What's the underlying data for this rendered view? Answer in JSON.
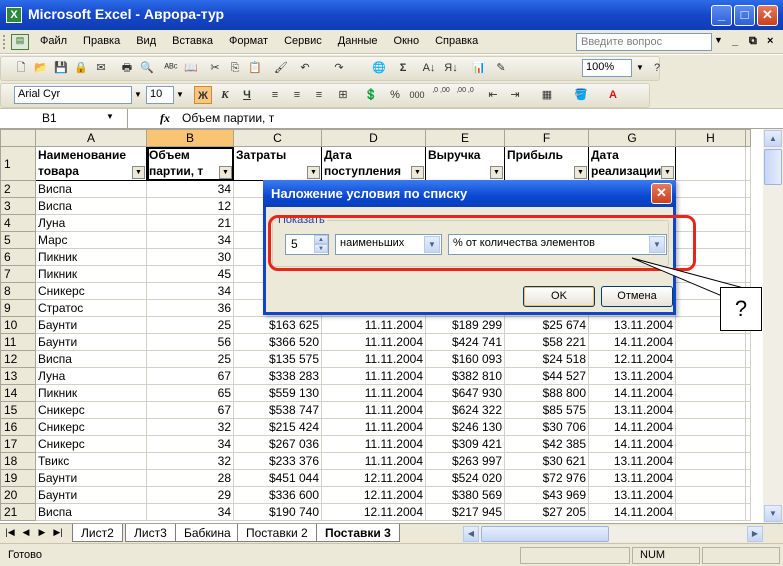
{
  "window": {
    "title": "Microsoft Excel - Аврора-тур",
    "app_icon": "excel-icon"
  },
  "menu": {
    "items": [
      "Файл",
      "Правка",
      "Вид",
      "Вставка",
      "Формат",
      "Сервис",
      "Данные",
      "Окно",
      "Справка"
    ],
    "help_placeholder": "Введите вопрос"
  },
  "toolbar": {
    "zoom": "100%",
    "font_name": "Arial Cyr",
    "font_size": "10",
    "bold": "Ж",
    "italic": "К",
    "underline": "Ч",
    "percent": "%",
    "thousands": "000",
    "inc_decimal": ",0 ,00",
    "dec_decimal": ",00 ,0",
    "sigma": "Σ"
  },
  "formula_bar": {
    "cell_ref": "B1",
    "fx": "fx",
    "content": "Объем партии, т"
  },
  "columns": [
    "A",
    "B",
    "C",
    "D",
    "E",
    "F",
    "G",
    "H"
  ],
  "header_row": {
    "row_number": "1",
    "cells": [
      [
        "Наименование",
        "товара"
      ],
      [
        "Объем",
        "партии, т"
      ],
      [
        "Затраты",
        ""
      ],
      [
        "Дата",
        "поступления"
      ],
      [
        "Выручка",
        ""
      ],
      [
        "Прибыль",
        ""
      ],
      [
        "Дата",
        "реализации"
      ]
    ]
  },
  "rows": [
    {
      "n": "2",
      "name": "Виспа",
      "qty": "34",
      "cost": "",
      "d1": "",
      "rev": "",
      "profit": "",
      "d2": ""
    },
    {
      "n": "3",
      "name": "Виспа",
      "qty": "12",
      "cost": "",
      "d1": "",
      "rev": "",
      "profit": "",
      "d2": ""
    },
    {
      "n": "4",
      "name": "Луна",
      "qty": "21",
      "cost": "",
      "d1": "",
      "rev": "",
      "profit": "",
      "d2": ""
    },
    {
      "n": "5",
      "name": "Марс",
      "qty": "34",
      "cost": "",
      "d1": "",
      "rev": "",
      "profit": "",
      "d2": ""
    },
    {
      "n": "6",
      "name": "Пикник",
      "qty": "30",
      "cost": "",
      "d1": "",
      "rev": "",
      "profit": "",
      "d2": ""
    },
    {
      "n": "7",
      "name": "Пикник",
      "qty": "45",
      "cost": "",
      "d1": "",
      "rev": "",
      "profit": "",
      "d2": ""
    },
    {
      "n": "8",
      "name": "Сникерс",
      "qty": "34",
      "cost": "",
      "d1": "",
      "rev": "",
      "profit": "",
      "d2": ""
    },
    {
      "n": "9",
      "name": "Стратос",
      "qty": "36",
      "cost": "",
      "d1": "",
      "rev": "",
      "profit": "",
      "d2": ""
    },
    {
      "n": "10",
      "name": "Баунти",
      "qty": "25",
      "cost": "$163 625",
      "d1": "11.11.2004",
      "rev": "$189 299",
      "profit": "$25 674",
      "d2": "13.11.2004"
    },
    {
      "n": "11",
      "name": "Баунти",
      "qty": "56",
      "cost": "$366 520",
      "d1": "11.11.2004",
      "rev": "$424 741",
      "profit": "$58 221",
      "d2": "14.11.2004"
    },
    {
      "n": "12",
      "name": "Виспа",
      "qty": "25",
      "cost": "$135 575",
      "d1": "11.11.2004",
      "rev": "$160 093",
      "profit": "$24 518",
      "d2": "12.11.2004"
    },
    {
      "n": "13",
      "name": "Луна",
      "qty": "67",
      "cost": "$338 283",
      "d1": "11.11.2004",
      "rev": "$382 810",
      "profit": "$44 527",
      "d2": "13.11.2004"
    },
    {
      "n": "14",
      "name": "Пикник",
      "qty": "65",
      "cost": "$559 130",
      "d1": "11.11.2004",
      "rev": "$647 930",
      "profit": "$88 800",
      "d2": "14.11.2004"
    },
    {
      "n": "15",
      "name": "Сникерс",
      "qty": "67",
      "cost": "$538 747",
      "d1": "11.11.2004",
      "rev": "$624 322",
      "profit": "$85 575",
      "d2": "13.11.2004"
    },
    {
      "n": "16",
      "name": "Сникерс",
      "qty": "32",
      "cost": "$215 424",
      "d1": "11.11.2004",
      "rev": "$246 130",
      "profit": "$30 706",
      "d2": "14.11.2004"
    },
    {
      "n": "17",
      "name": "Сникерс",
      "qty": "34",
      "cost": "$267 036",
      "d1": "11.11.2004",
      "rev": "$309 421",
      "profit": "$42 385",
      "d2": "14.11.2004"
    },
    {
      "n": "18",
      "name": "Твикс",
      "qty": "32",
      "cost": "$233 376",
      "d1": "11.11.2004",
      "rev": "$263 997",
      "profit": "$30 621",
      "d2": "13.11.2004"
    },
    {
      "n": "19",
      "name": "Баунти",
      "qty": "28",
      "cost": "$451 044",
      "d1": "12.11.2004",
      "rev": "$524 020",
      "profit": "$72 976",
      "d2": "13.11.2004"
    },
    {
      "n": "20",
      "name": "Баунти",
      "qty": "29",
      "cost": "$336 600",
      "d1": "12.11.2004",
      "rev": "$380 569",
      "profit": "$43 969",
      "d2": "13.11.2004"
    },
    {
      "n": "21",
      "name": "Виспа",
      "qty": "34",
      "cost": "$190 740",
      "d1": "12.11.2004",
      "rev": "$217 945",
      "profit": "$27 205",
      "d2": "14.11.2004"
    }
  ],
  "sheet_tabs": [
    "Лист2",
    "Лист3",
    "Бабкина",
    "Поставки 2",
    "Поставки 3"
  ],
  "active_tab": "Поставки 3",
  "status": {
    "left": "Готово",
    "num": "NUM"
  },
  "dialog": {
    "title": "Наложение условия по списку",
    "group_label": "Показать",
    "count_value": "5",
    "mode_value": "наименьших",
    "unit_value": "% от количества элементов",
    "ok_label": "OK",
    "cancel_label": "Отмена"
  },
  "callout": {
    "text": "?"
  },
  "colors": {
    "titlebar": "#1547c9",
    "highlight": "#e8251b",
    "selected_header": "#f9c575"
  }
}
